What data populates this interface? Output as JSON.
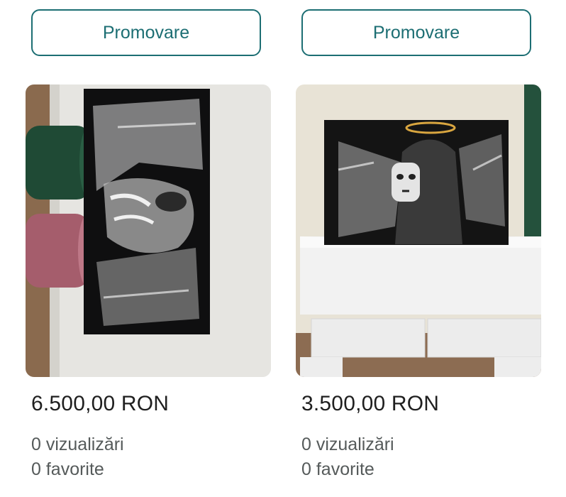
{
  "listings": [
    {
      "promote_label": "Promovare",
      "price": "6.500,00 RON",
      "views": "0 vizualizări",
      "favorites": "0 favorite"
    },
    {
      "promote_label": "Promovare",
      "price": "3.500,00 RON",
      "views": "0 vizualizări",
      "favorites": "0 favorite"
    }
  ],
  "colors": {
    "accent": "#1c6e73",
    "price_text": "#1f1f1f",
    "meta_text": "#555a5a"
  }
}
